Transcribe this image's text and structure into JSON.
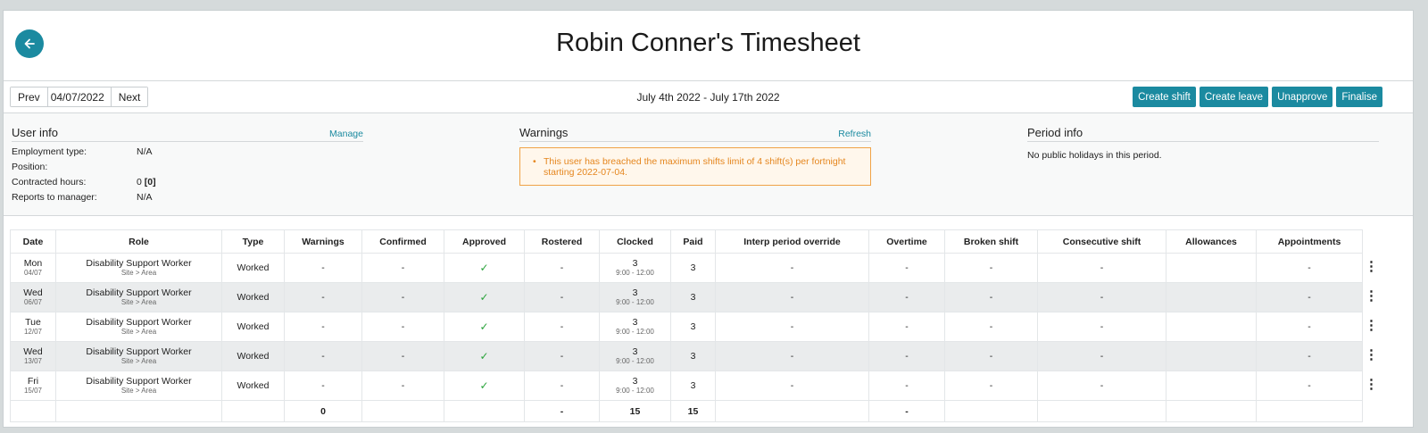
{
  "header": {
    "title": "Robin Conner's Timesheet"
  },
  "toolbar": {
    "prev_label": "Prev",
    "date_value": "04/07/2022",
    "next_label": "Next",
    "range_text": "July 4th 2022 - July 17th 2022",
    "actions": [
      "Create shift",
      "Create leave",
      "Unapprove",
      "Finalise"
    ]
  },
  "user_info": {
    "title": "User info",
    "manage_label": "Manage",
    "fields": [
      {
        "label": "Employment type:",
        "value": "N/A"
      },
      {
        "label": "Position:",
        "value": ""
      },
      {
        "label": "Contracted hours:",
        "value": "0",
        "bold_value": "[0]"
      },
      {
        "label": "Reports to manager:",
        "value": "N/A"
      }
    ]
  },
  "warnings": {
    "title": "Warnings",
    "refresh_label": "Refresh",
    "bullet": "•",
    "message_line1": "This user has breached the maximum shifts limit of 4 shift(s) per fortnight",
    "message_line2": "starting 2022-07-04."
  },
  "period_info": {
    "title": "Period info",
    "text": "No public holidays in this period."
  },
  "table": {
    "columns": [
      "Date",
      "Role",
      "Type",
      "Warnings",
      "Confirmed",
      "Approved",
      "Rostered",
      "Clocked",
      "Paid",
      "Interp period override",
      "Overtime",
      "Broken shift",
      "Consecutive shift",
      "Allowances",
      "Appointments"
    ],
    "rows": [
      {
        "day": "Mon",
        "date": "04/07",
        "role": "Disability Support Worker",
        "site": "Site > Area",
        "type": "Worked",
        "warnings": "-",
        "confirmed": "-",
        "approved": "✓",
        "rostered": "-",
        "clocked": "3",
        "clocked_time": "9:00 - 12:00",
        "paid": "3",
        "interp": "-",
        "overtime": "-",
        "broken": "-",
        "consecutive": "-",
        "allowances": "",
        "appointments": "-"
      },
      {
        "day": "Wed",
        "date": "06/07",
        "role": "Disability Support Worker",
        "site": "Site > Area",
        "type": "Worked",
        "warnings": "-",
        "confirmed": "-",
        "approved": "✓",
        "rostered": "-",
        "clocked": "3",
        "clocked_time": "9:00 - 12:00",
        "paid": "3",
        "interp": "-",
        "overtime": "-",
        "broken": "-",
        "consecutive": "-",
        "allowances": "",
        "appointments": "-"
      },
      {
        "day": "Tue",
        "date": "12/07",
        "role": "Disability Support Worker",
        "site": "Site > Area",
        "type": "Worked",
        "warnings": "-",
        "confirmed": "-",
        "approved": "✓",
        "rostered": "-",
        "clocked": "3",
        "clocked_time": "9:00 - 12:00",
        "paid": "3",
        "interp": "-",
        "overtime": "-",
        "broken": "-",
        "consecutive": "-",
        "allowances": "",
        "appointments": "-"
      },
      {
        "day": "Wed",
        "date": "13/07",
        "role": "Disability Support Worker",
        "site": "Site > Area",
        "type": "Worked",
        "warnings": "-",
        "confirmed": "-",
        "approved": "✓",
        "rostered": "-",
        "clocked": "3",
        "clocked_time": "9:00 - 12:00",
        "paid": "3",
        "interp": "-",
        "overtime": "-",
        "broken": "-",
        "consecutive": "-",
        "allowances": "",
        "appointments": "-"
      },
      {
        "day": "Fri",
        "date": "15/07",
        "role": "Disability Support Worker",
        "site": "Site > Area",
        "type": "Worked",
        "warnings": "-",
        "confirmed": "-",
        "approved": "✓",
        "rostered": "-",
        "clocked": "3",
        "clocked_time": "9:00 - 12:00",
        "paid": "3",
        "interp": "-",
        "overtime": "-",
        "broken": "-",
        "consecutive": "-",
        "allowances": "",
        "appointments": "-"
      }
    ],
    "totals": {
      "warnings": "0",
      "rostered": "-",
      "clocked": "15",
      "paid": "15",
      "overtime": "-"
    }
  },
  "icons": {
    "back": "arrow-left-icon",
    "row_menu": "kebab-menu-icon",
    "approved": "check-icon"
  },
  "colors": {
    "accent": "#1b8aa0",
    "warning_text": "#e5861e",
    "warning_border": "#f0a347",
    "check": "#2aa33b"
  }
}
